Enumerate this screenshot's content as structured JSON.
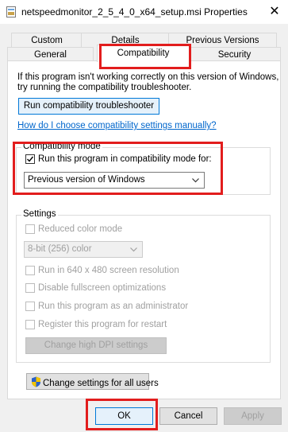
{
  "window": {
    "title": "netspeedmonitor_2_5_4_0_x64_setup.msi Properties"
  },
  "tabs": {
    "row1": [
      "Custom",
      "Details",
      "Previous Versions"
    ],
    "row2": [
      "General",
      "Compatibility",
      "Security"
    ]
  },
  "intro": {
    "line1": "If this program isn't working correctly on this version of Windows,",
    "line2": "try running the compatibility troubleshooter.",
    "troubleshooter_button": "Run compatibility troubleshooter",
    "help_link": "How do I choose compatibility settings manually?"
  },
  "compat_mode": {
    "group_label": "Compatibility mode",
    "checkbox_label": "Run this program in compatibility mode for:",
    "checked": true,
    "selected": "Previous version of Windows"
  },
  "settings": {
    "group_label": "Settings",
    "reduced_color": "Reduced color mode",
    "color_depth": "8-bit (256) color",
    "run_640": "Run in 640 x 480 screen resolution",
    "disable_fullscreen": "Disable fullscreen optimizations",
    "run_admin": "Run this program as an administrator",
    "register_restart": "Register this program for restart",
    "dpi_button": "Change high DPI settings"
  },
  "all_users_button": "Change settings for all users",
  "footer": {
    "ok": "OK",
    "cancel": "Cancel",
    "apply": "Apply"
  },
  "colors": {
    "highlight": "#e21d1d",
    "link": "#0066cc",
    "focus": "#0078d7"
  },
  "icons": {
    "title": "installer-package-icon",
    "shield": "uac-shield-icon"
  }
}
